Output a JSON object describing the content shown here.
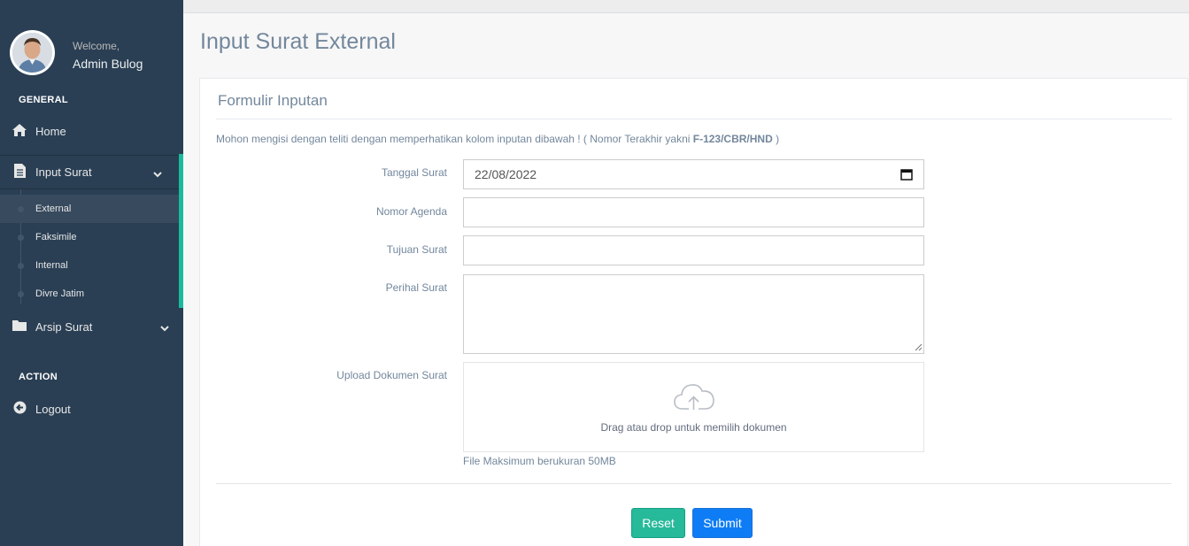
{
  "sidebar": {
    "welcome": "Welcome,",
    "username": "Admin Bulog",
    "general_title": "GENERAL",
    "action_title": "ACTION",
    "items": [
      {
        "label": "Home",
        "icon": "home-icon"
      },
      {
        "label": "Input Surat",
        "icon": "file-icon"
      },
      {
        "label": "Arsip Surat",
        "icon": "folder-icon"
      },
      {
        "label": "Logout",
        "icon": "logout-icon"
      }
    ],
    "submenu": [
      {
        "label": "External"
      },
      {
        "label": "Faksimile"
      },
      {
        "label": "Internal"
      },
      {
        "label": "Divre Jatim"
      }
    ],
    "accent_color": "#1ABB9C"
  },
  "page": {
    "title": "Input Surat External"
  },
  "panel": {
    "title": "Formulir Inputan",
    "instruction_prefix": "Mohon mengisi dengan teliti dengan memperhatikan kolom inputan dibawah ! ( Nomor Terakhir yakni ",
    "instruction_number": "F-123/CBR/HND",
    "instruction_suffix": " )"
  },
  "form": {
    "tanggal_label": "Tanggal Surat",
    "tanggal_value": "22/08/2022",
    "nomor_label": "Nomor Agenda",
    "nomor_value": "",
    "tujuan_label": "Tujuan Surat",
    "tujuan_value": "",
    "perihal_label": "Perihal Surat",
    "perihal_value": "",
    "upload_label": "Upload Dokumen Surat",
    "drop_text": "Drag atau drop untuk memilih dokumen",
    "file_note": "File Maksimum berukuran 50MB",
    "reset_label": "Reset",
    "submit_label": "Submit"
  }
}
